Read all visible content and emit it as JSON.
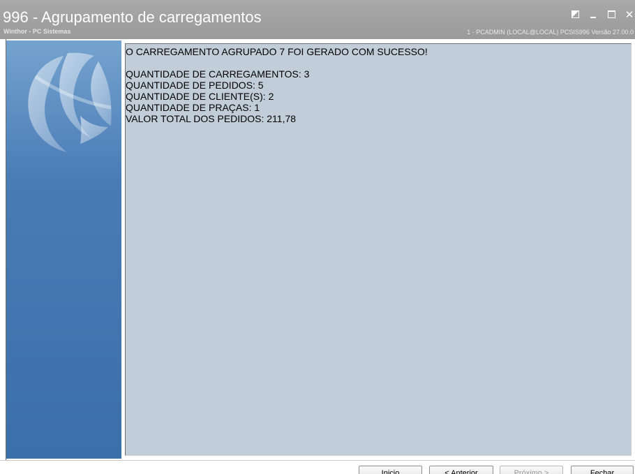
{
  "window": {
    "title": "996 - Agrupamento de carregamentos",
    "subtitle": "Winthor - PC Sistemas",
    "session_info": "1 - PCADMIN (LOCAL@LOCAL)  PCSIS996  Versão 27.00.0"
  },
  "message": {
    "header": "O CARREGAMENTO AGRUPADO 7 FOI GERADO COM SUCESSO!",
    "lines": [
      "QUANTIDADE DE CARREGAMENTOS: 3",
      "QUANTIDADE DE PEDIDOS: 5",
      "QUANTIDADE DE CLIENTE(S): 2",
      "QUANTIDADE DE PRAÇAS: 1",
      "VALOR TOTAL DOS PEDIDOS: 211,78"
    ]
  },
  "buttons": {
    "inicio": {
      "label": "Inicio"
    },
    "anterior": {
      "label": "< Anterior"
    },
    "proximo": {
      "label": "Próximo >"
    },
    "fechar": {
      "label": "Fechar"
    }
  },
  "icons": {
    "restore": "restore-icon",
    "minimize": "minimize-icon",
    "maximize": "maximize-icon",
    "close": "close-icon",
    "logo": "winthor-logo-icon"
  },
  "colors": {
    "titlebar": "#a0a0a0",
    "side_panel": "#4a7bb5",
    "content_bg": "#c1cdd9"
  }
}
